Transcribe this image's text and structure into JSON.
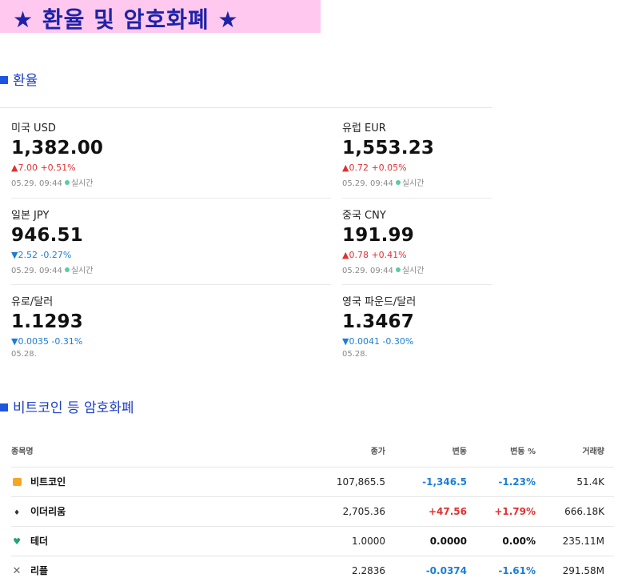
{
  "banner": {
    "title": "★ 환율 및 암호화폐 ★"
  },
  "exchange": {
    "heading": "환율",
    "rates": [
      {
        "name": "미국 USD",
        "value": "1,382.00",
        "change": "▲7.00  +0.51%",
        "direction": "up",
        "time": "05.29. 09:44",
        "live": "실시간"
      },
      {
        "name": "유럽 EUR",
        "value": "1,553.23",
        "change": "▲0.72  +0.05%",
        "direction": "up",
        "time": "05.29. 09:44",
        "live": "실시간"
      },
      {
        "name": "일본 JPY",
        "value": "946.51",
        "change": "▼2.52  -0.27%",
        "direction": "down",
        "time": "05.29. 09:44",
        "live": "실시간"
      },
      {
        "name": "중국 CNY",
        "value": "191.99",
        "change": "▲0.78  +0.41%",
        "direction": "up",
        "time": "05.29. 09:44",
        "live": "실시간"
      },
      {
        "name": "유로/달러",
        "value": "1.1293",
        "change": "▼0.0035  -0.31%",
        "direction": "down",
        "time": "05.28.",
        "live": ""
      },
      {
        "name": "영국 파운드/달러",
        "value": "1.3467",
        "change": "▼0.0041  -0.30%",
        "direction": "down",
        "time": "05.28.",
        "live": ""
      }
    ]
  },
  "crypto": {
    "heading": "비트코인 등 암호화폐",
    "columns": {
      "name": "종목명",
      "price": "종가",
      "change": "변동",
      "pct": "변동 %",
      "volume": "거래량"
    },
    "rows": [
      {
        "icon": "bitcoin-icon",
        "name": "비트코인",
        "price": "107,865.5",
        "change": "-1,346.5",
        "pct": "-1.23%",
        "volume": "51.4K",
        "direction": "down"
      },
      {
        "icon": "ethereum-icon",
        "name": "이더리움",
        "price": "2,705.36",
        "change": "+47.56",
        "pct": "+1.79%",
        "volume": "666.18K",
        "direction": "up"
      },
      {
        "icon": "tether-icon",
        "name": "테더",
        "price": "1.0000",
        "change": "0.0000",
        "pct": "0.00%",
        "volume": "235.11M",
        "direction": "flat"
      },
      {
        "icon": "ripple-icon",
        "name": "리플",
        "price": "2.2836",
        "change": "-0.0374",
        "pct": "-1.61%",
        "volume": "291.58M",
        "direction": "down"
      }
    ]
  },
  "colors": {
    "banner_bg": "#ffc8ef",
    "banner_text": "#1f22a8",
    "heading": "#1d3fc4",
    "up": "#e03131",
    "down": "#1c7ed6"
  }
}
